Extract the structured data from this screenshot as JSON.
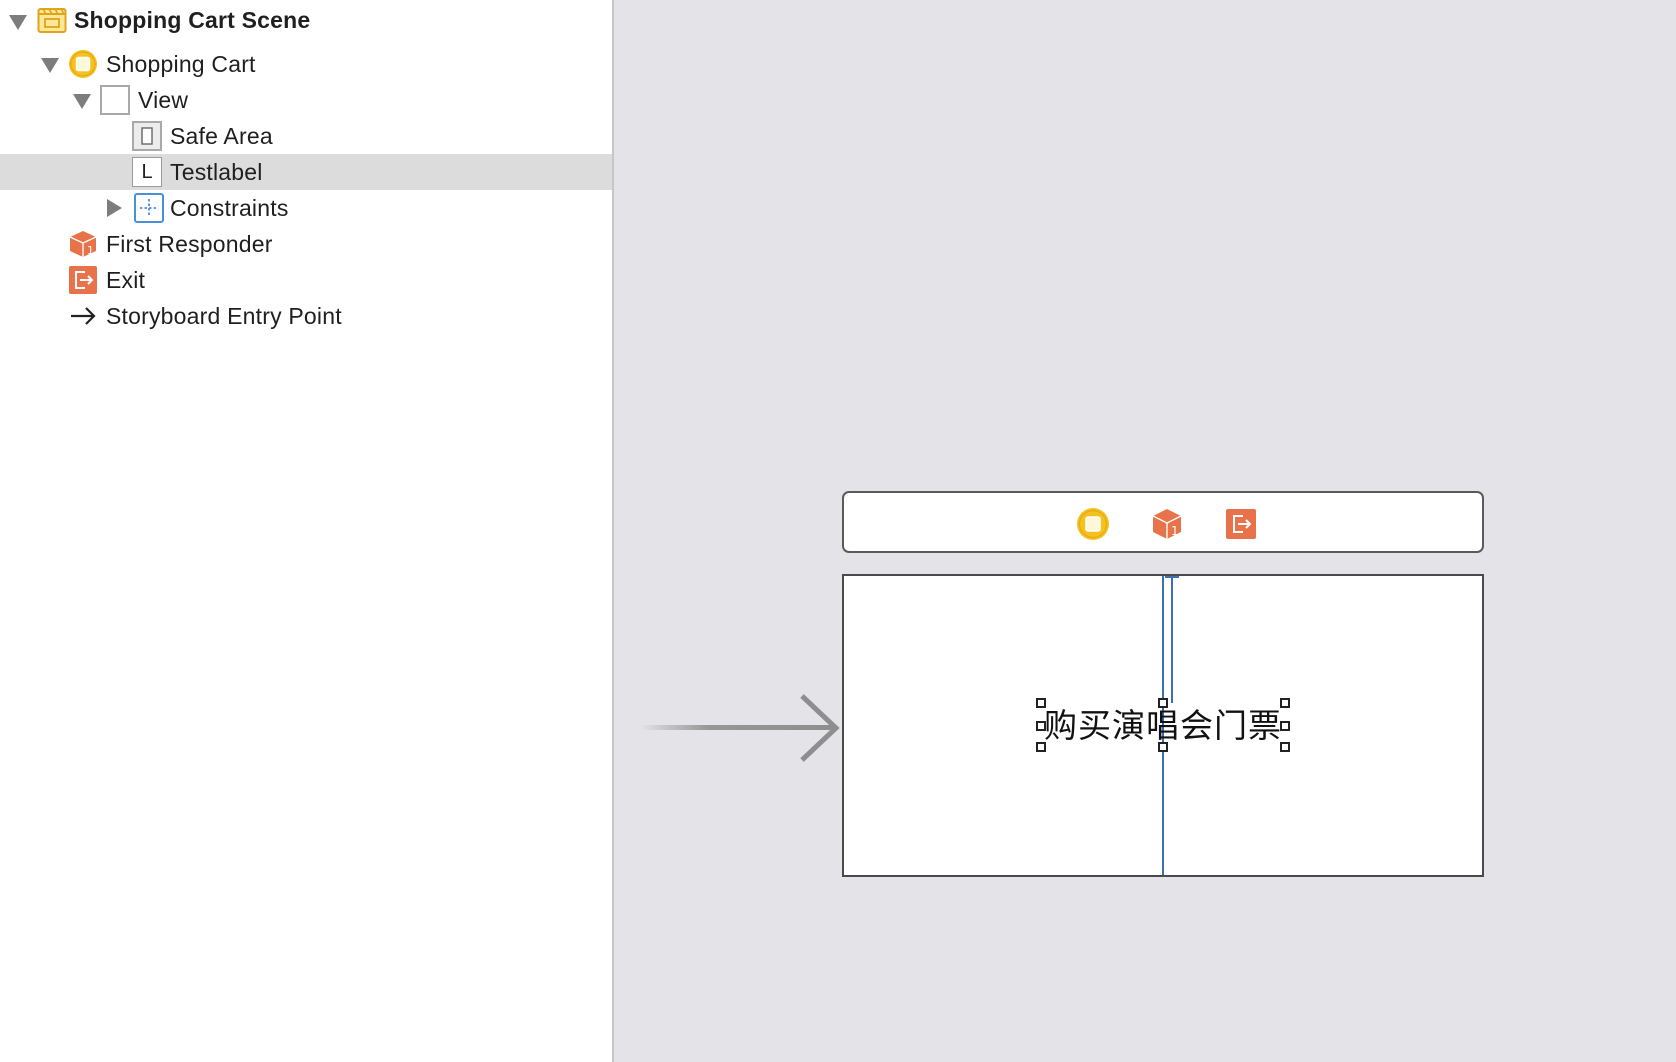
{
  "outline": {
    "items": [
      {
        "label": "Shopping Cart Scene",
        "icon": "scene-icon",
        "disclosure": "expanded"
      },
      {
        "label": "Shopping Cart",
        "icon": "view-controller-icon",
        "disclosure": "expanded"
      },
      {
        "label": "View",
        "icon": "view-icon",
        "disclosure": "expanded"
      },
      {
        "label": "Safe Area",
        "icon": "safe-area-icon"
      },
      {
        "label": "Testlabel",
        "icon": "label-icon",
        "selected": true
      },
      {
        "label": "Constraints",
        "icon": "constraints-icon",
        "disclosure": "collapsed"
      },
      {
        "label": "First Responder",
        "icon": "first-responder-icon"
      },
      {
        "label": "Exit",
        "icon": "exit-icon"
      },
      {
        "label": "Storyboard Entry Point",
        "icon": "arrow-right-icon"
      }
    ],
    "label_glyph": "L"
  },
  "canvas": {
    "dock_icons": [
      "view-controller-icon",
      "first-responder-icon",
      "exit-icon"
    ],
    "testlabel_text": "购买演唱会门票"
  },
  "colors": {
    "accent_yellow": "#f5c11f",
    "accent_orange": "#e8734a",
    "constraint_blue": "#3d6fb6",
    "selection_bg": "#dcdcdc",
    "canvas_bg": "#e3e3e8"
  }
}
